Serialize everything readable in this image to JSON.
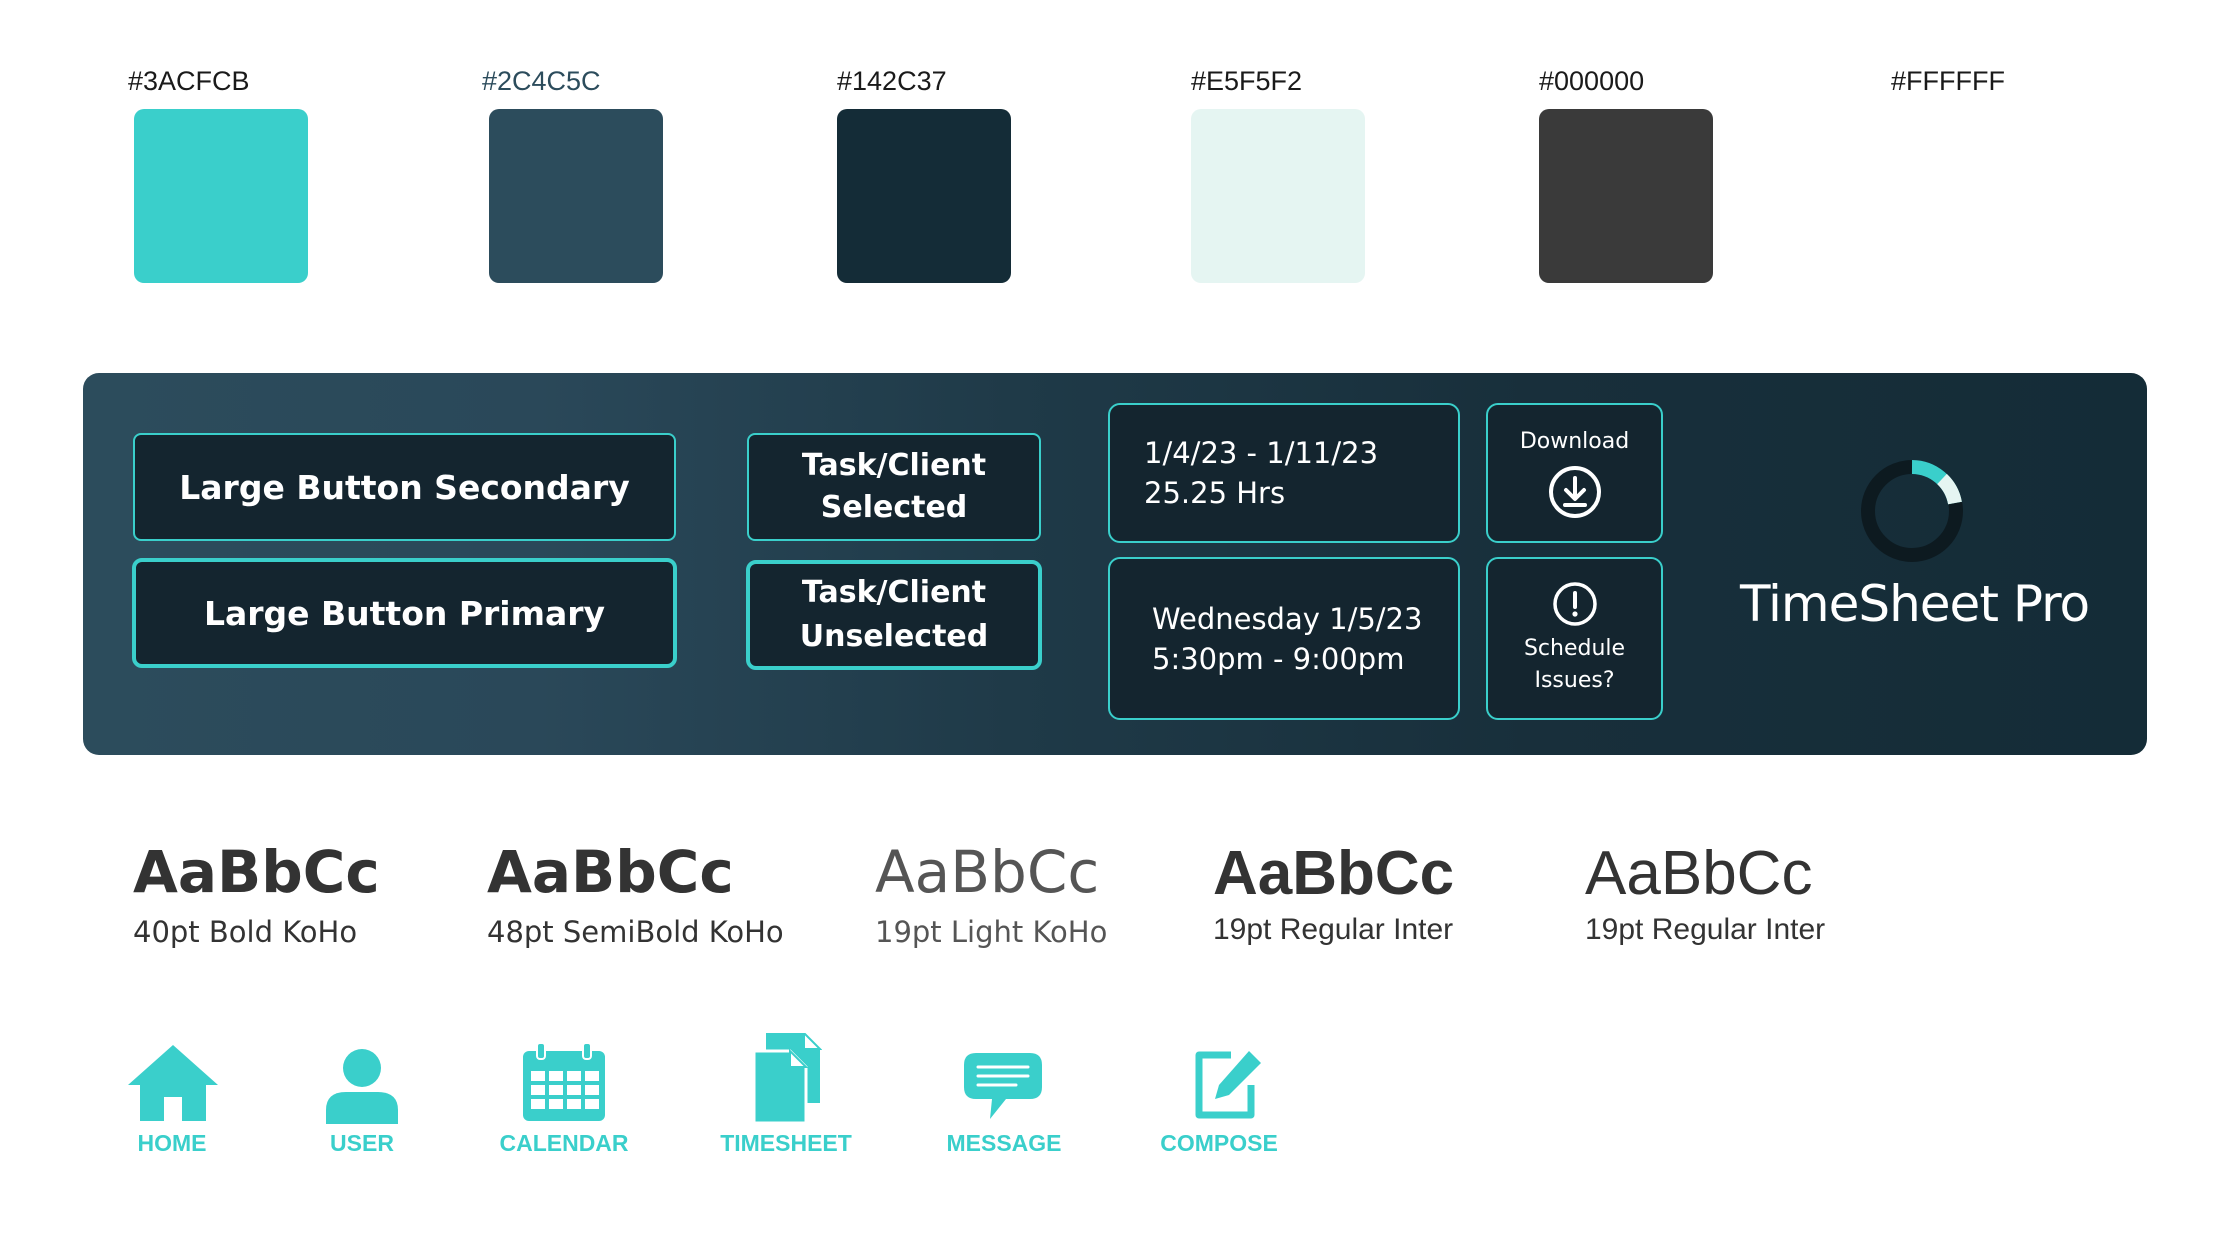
{
  "palette": [
    {
      "label": "#3ACFCB",
      "color": "#3ACFCB"
    },
    {
      "label": "#2C4C5C",
      "color": "#2C4C5C"
    },
    {
      "label": "#142C37",
      "color": "#142C37"
    },
    {
      "label": "#E5F5F2",
      "color": "#E5F5F2"
    },
    {
      "label": "#000000",
      "color": "#3a3a3a"
    },
    {
      "label": "#FFFFFF",
      "color": "#FFFFFF"
    }
  ],
  "buttons": {
    "large_secondary": "Large Button Secondary",
    "large_primary": "Large Button Primary",
    "task_selected_1": "Task/Client",
    "task_selected_2": "Selected",
    "task_unselected_1": "Task/Client",
    "task_unselected_2": "Unselected"
  },
  "cards": {
    "range_dates": "1/4/23 - 1/11/23",
    "range_hours": "25.25 Hrs",
    "shift_day": "Wednesday 1/5/23",
    "shift_time": "5:30pm - 9:00pm",
    "download_label": "Download",
    "schedule_label_1": "Schedule",
    "schedule_label_2": "Issues?"
  },
  "brand": {
    "name": "TimeSheet Pro",
    "accent": "#3ACFCB"
  },
  "typography": [
    {
      "sample": "AaBbCc",
      "caption": "40pt Bold KoHo"
    },
    {
      "sample": "AaBbCc",
      "caption": "48pt SemiBold KoHo"
    },
    {
      "sample": "AaBbCc",
      "caption": "19pt Light KoHo"
    },
    {
      "sample": "AaBbCc",
      "caption": "19pt Regular Inter"
    },
    {
      "sample": "AaBbCc",
      "caption": "19pt Regular Inter"
    }
  ],
  "nav": [
    {
      "label": "HOME",
      "icon": "home-icon"
    },
    {
      "label": "USER",
      "icon": "user-icon"
    },
    {
      "label": "CALENDAR",
      "icon": "calendar-icon"
    },
    {
      "label": "TIMESHEET",
      "icon": "timesheet-icon"
    },
    {
      "label": "MESSAGE",
      "icon": "message-icon"
    },
    {
      "label": "COMPOSE",
      "icon": "compose-icon"
    }
  ]
}
